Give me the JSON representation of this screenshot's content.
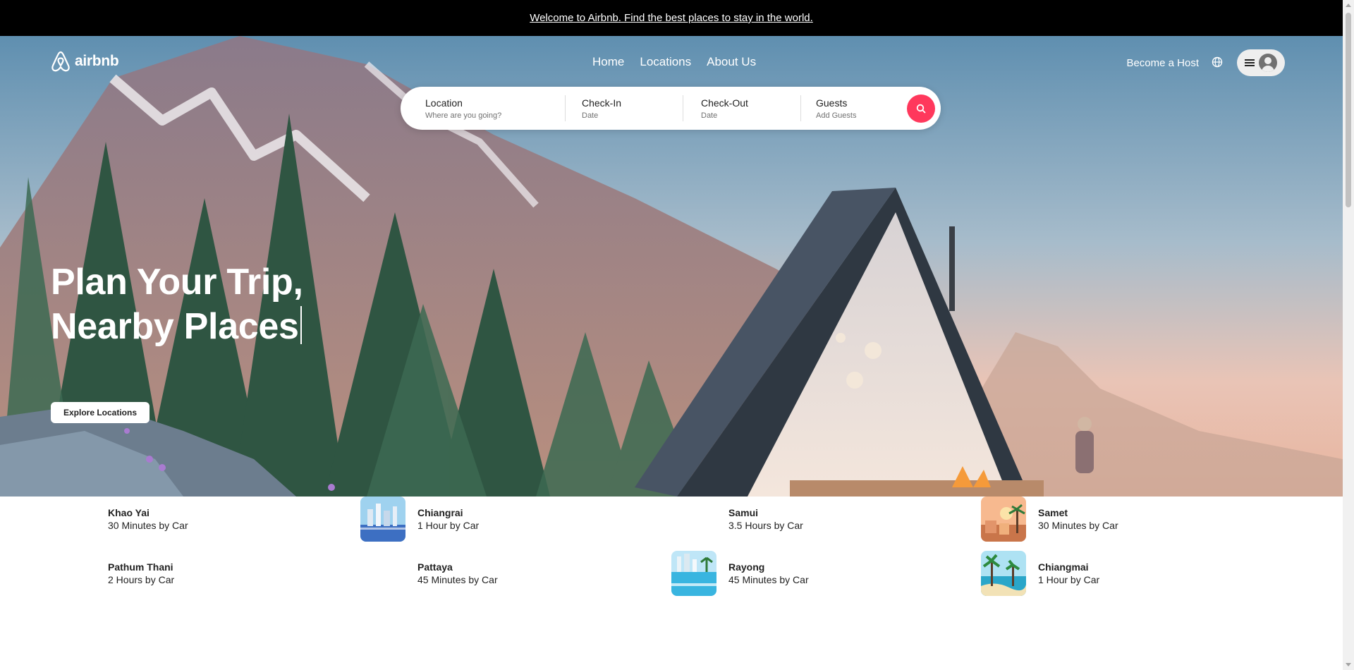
{
  "banner": {
    "text": "Welcome to Airbnb. Find the best places to stay in the world."
  },
  "brand": {
    "name": "airbnb",
    "accent": "#ff385c"
  },
  "nav": {
    "links": [
      "Home",
      "Locations",
      "About Us"
    ],
    "host_label": "Become a Host",
    "icons": {
      "language": "globe-icon",
      "menu": "hamburger-icon",
      "user": "user-avatar-icon"
    }
  },
  "search": {
    "fields": [
      {
        "label": "Location",
        "sub": "Where are you going?"
      },
      {
        "label": "Check-In",
        "sub": "Date"
      },
      {
        "label": "Check-Out",
        "sub": "Date"
      },
      {
        "label": "Guests",
        "sub": "Add Guests"
      }
    ],
    "button_icon": "search-icon"
  },
  "hero": {
    "title_line1": "Plan Your Trip,",
    "title_line2": "Nearby Places",
    "cta": "Explore Locations"
  },
  "nearby": [
    {
      "name": "Khao Yai",
      "distance": "30 Minutes by Car",
      "thumbnail": "none"
    },
    {
      "name": "Chiangrai",
      "distance": "1 Hour by Car",
      "thumbnail": "city-river"
    },
    {
      "name": "Samui",
      "distance": "3.5 Hours by Car",
      "thumbnail": "none"
    },
    {
      "name": "Samet",
      "distance": "30 Minutes by Car",
      "thumbnail": "sunset-palms"
    },
    {
      "name": "Pathum Thani",
      "distance": "2 Hours by Car",
      "thumbnail": "none"
    },
    {
      "name": "Pattaya",
      "distance": "45 Minutes by Car",
      "thumbnail": "none"
    },
    {
      "name": "Rayong",
      "distance": "45 Minutes by Car",
      "thumbnail": "pool-resort"
    },
    {
      "name": "Chiangmai",
      "distance": "1 Hour by Car",
      "thumbnail": "beach-palms"
    }
  ]
}
